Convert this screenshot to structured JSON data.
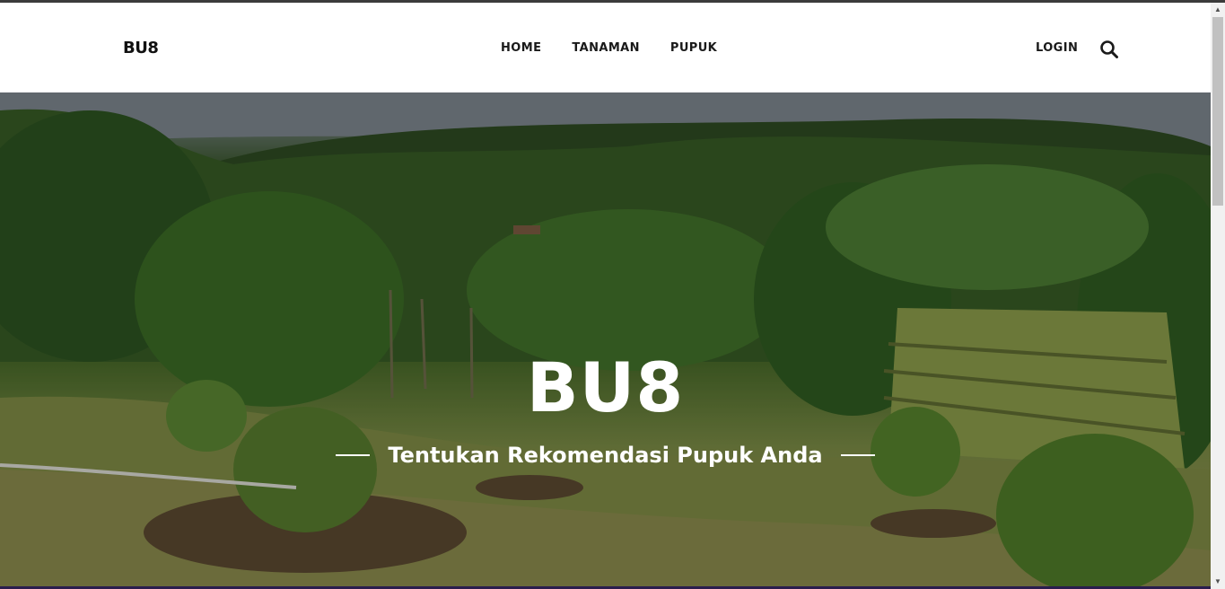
{
  "navbar": {
    "logo": "BU8",
    "links": [
      "HOME",
      "TANAMAN",
      "PUPUK"
    ],
    "login": "LOGIN",
    "search_icon": "search-icon"
  },
  "hero": {
    "title": "BU8",
    "subtitle": "Tentukan Rekomendasi Pupuk Anda"
  },
  "colors": {
    "nav_text": "#1a1a1a",
    "hero_text": "#ffffff",
    "top_border": "#3b3b3b"
  }
}
